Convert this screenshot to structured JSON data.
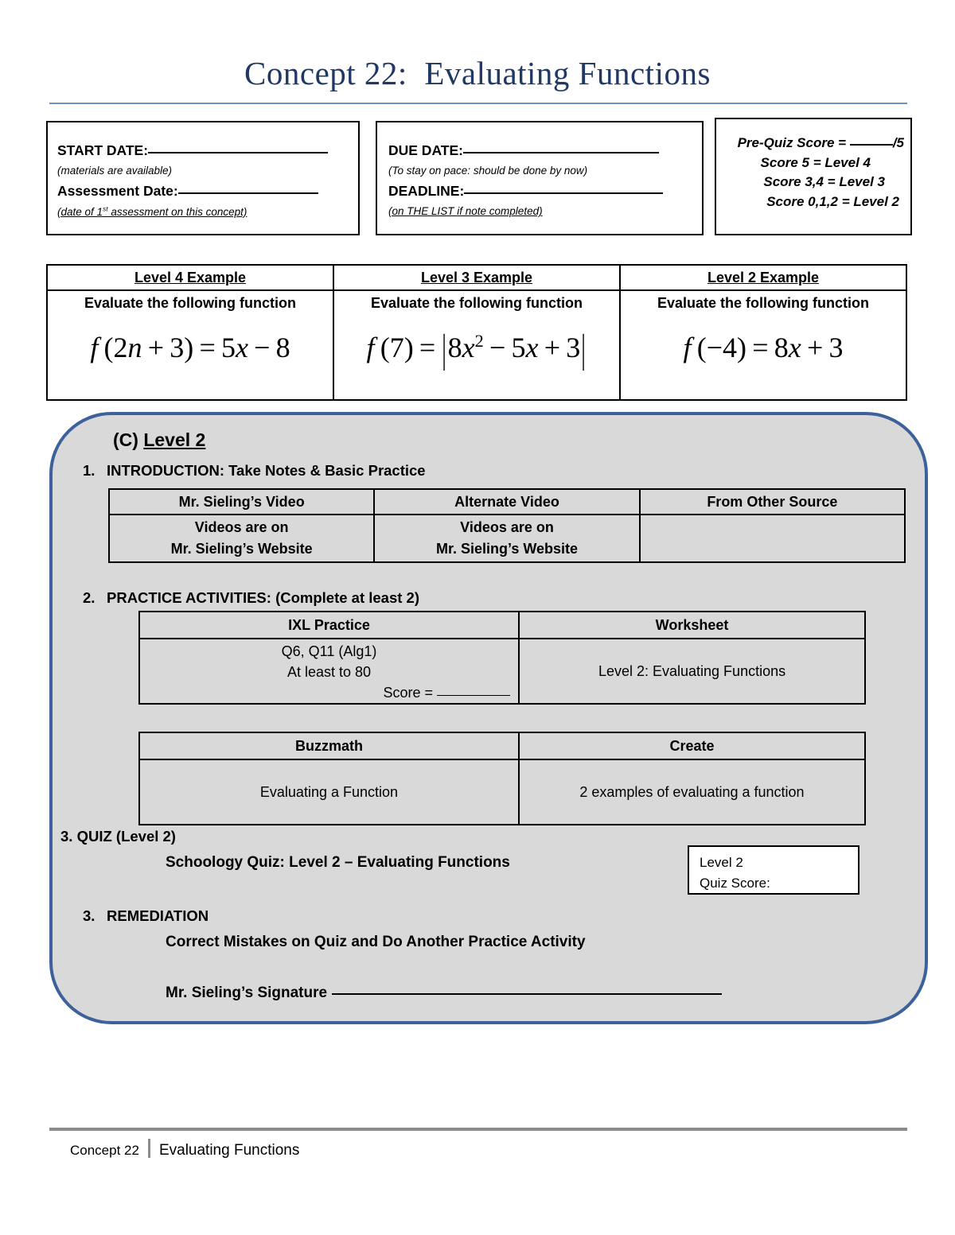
{
  "title": "Concept 22:  Evaluating Functions",
  "header": {
    "start_box": {
      "start_label": "START DATE:",
      "start_note": "(materials are available)",
      "assessment_label": "Assessment Date:",
      "assessment_note": "(date of 1st assessment on this concept)"
    },
    "due_box": {
      "due_label": "DUE DATE:",
      "due_note": "(To stay on pace: should be done by now)",
      "deadline_label": "DEADLINE:",
      "deadline_note": "(on THE LIST if note completed)"
    },
    "score_box": {
      "prequiz_prefix": "Pre-Quiz Score = ",
      "prequiz_suffix": "/5",
      "line2": "Score 5 = Level 4",
      "line3": "Score  3,4 = Level 3",
      "line4": "Score 0,1,2 = Level 2"
    }
  },
  "examples": [
    {
      "heading": "Level 4 Example",
      "instruction": "Evaluate the following function",
      "equation": "f (2n + 3) = 5x − 8"
    },
    {
      "heading": "Level 3 Example",
      "instruction": "Evaluate the following function",
      "equation": "f (7) = |8x² − 5x + 3|"
    },
    {
      "heading": "Level 2 Example",
      "instruction": "Evaluate the following function",
      "equation": "f (−4) = 8x + 3"
    }
  ],
  "panel": {
    "heading_prefix": "(C) ",
    "heading_level": "Level 2",
    "step1": {
      "number": "1.",
      "label": "INTRODUCTION:  Take Notes & Basic Practice",
      "table": {
        "headers": [
          "Mr. Sieling’s Video",
          "Alternate Video",
          "From Other Source"
        ],
        "row": [
          "Videos are on\nMr. Sieling’s Website",
          "Videos are on\nMr. Sieling’s Website",
          ""
        ],
        "cell1_line1": "Videos are on",
        "cell1_line2": "Mr. Sieling’s Website",
        "cell2_line1": "Videos are on",
        "cell2_line2": "Mr. Sieling’s Website",
        "cell3": ""
      }
    },
    "step2": {
      "number": "2.",
      "label": "PRACTICE ACTIVITIES:  (Complete at least 2)",
      "table_a": {
        "headers": [
          "IXL Practice",
          "Worksheet"
        ],
        "ixl_line1": "Q6, Q11 (Alg1)",
        "ixl_line2": "At least to 80",
        "ixl_score_label": "Score = ",
        "worksheet": "Level 2: Evaluating Functions"
      },
      "table_b": {
        "headers": [
          "Buzzmath",
          "Create"
        ],
        "buzzmath": "Evaluating a Function",
        "create": "2 examples of evaluating a function"
      }
    },
    "step3_quiz": {
      "number": "3.",
      "label": "QUIZ (Level 2)",
      "detail": "Schoology Quiz:  Level 2 – Evaluating Functions",
      "score_box_line1": "Level 2",
      "score_box_line2": "Quiz Score:"
    },
    "step3_remediation": {
      "number": "3.",
      "label": "REMEDIATION",
      "detail": "Correct Mistakes on Quiz and Do Another Practice Activity",
      "signature_label": "Mr. Sieling’s Signature"
    }
  },
  "footer": {
    "left": "Concept 22",
    "right": "Evaluating Functions"
  },
  "colors": {
    "title": "#1F3864",
    "title_rule": "#6F93BD",
    "panel_border": "#3D629B",
    "panel_fill": "#D9D9D9",
    "footer_rule": "#8C8C8C"
  }
}
